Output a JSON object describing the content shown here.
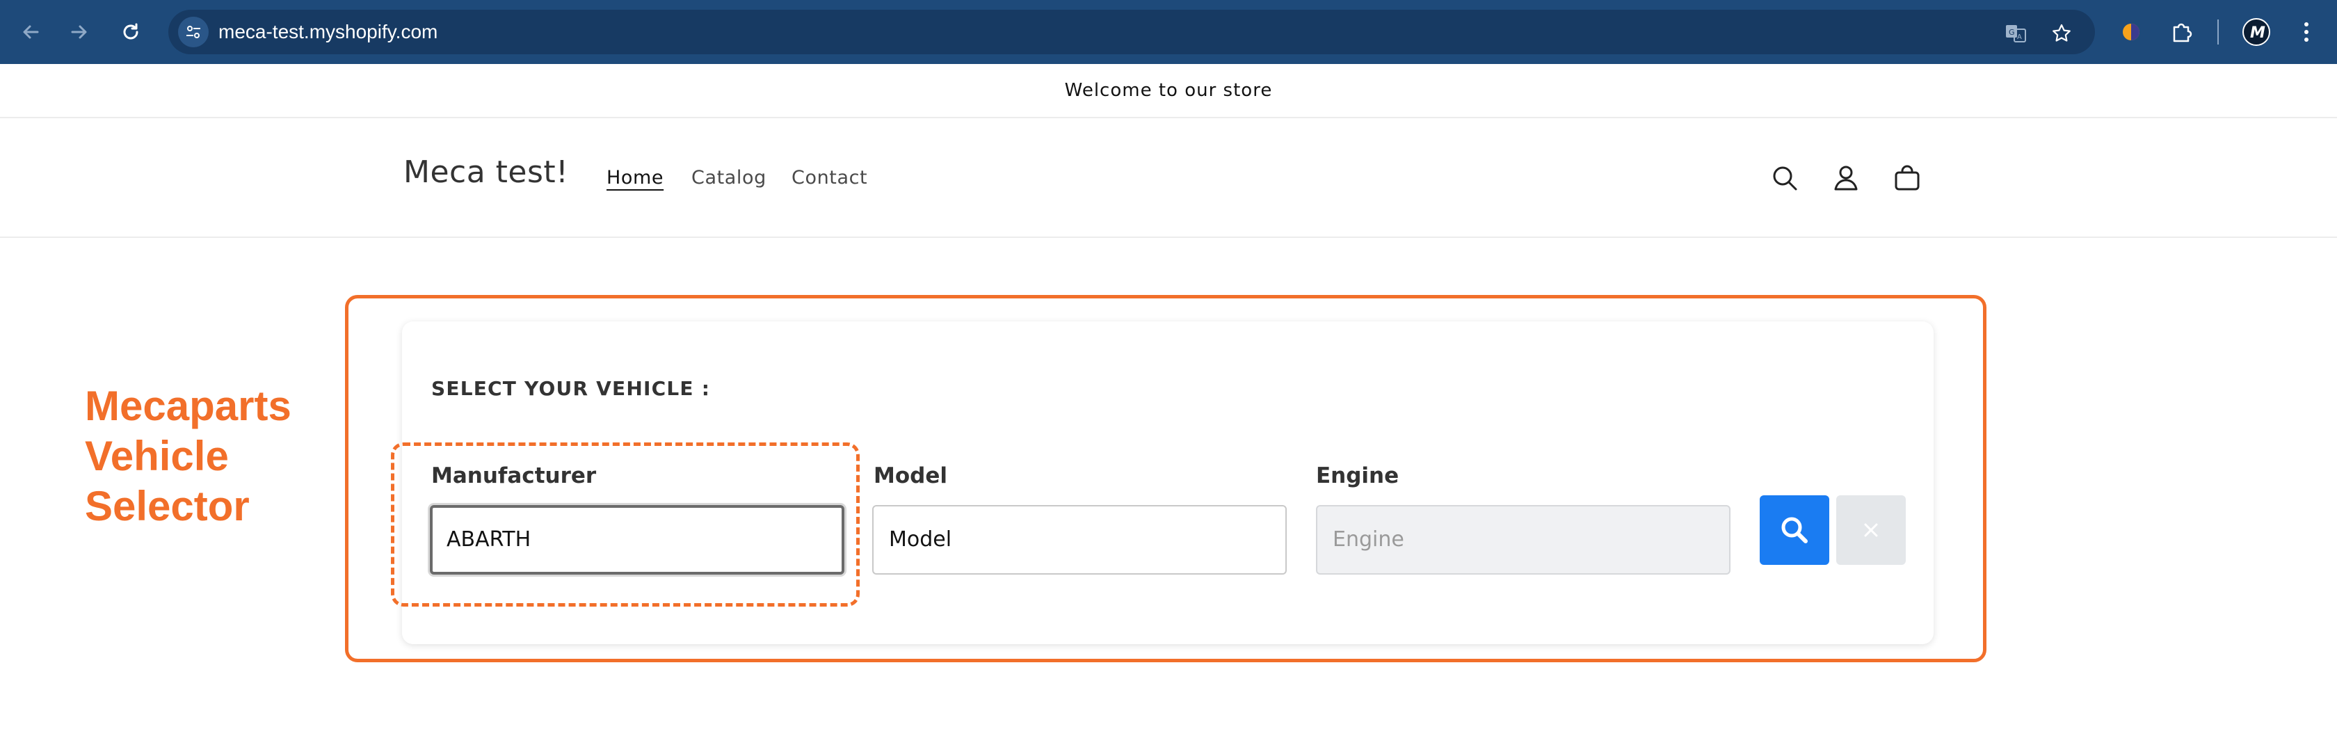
{
  "browser": {
    "url": "meca-test.myshopify.com",
    "icons": [
      "back-arrow-icon",
      "forward-arrow-icon",
      "reload-icon",
      "site-info-icon",
      "translate-icon",
      "bookmark-star-icon",
      "extension-icon",
      "puzzle-icon",
      "profile-icon",
      "more-vert-icon"
    ]
  },
  "announcement": {
    "text": "Welcome to our store"
  },
  "header": {
    "store_name": "Meca test!",
    "nav": [
      {
        "label": "Home",
        "active": true
      },
      {
        "label": "Catalog",
        "active": false
      },
      {
        "label": "Contact",
        "active": false
      }
    ],
    "icons": [
      "search-icon",
      "account-icon",
      "cart-icon"
    ]
  },
  "annotation": {
    "title": "Mecaparts Vehicle Selector",
    "color": "#f26f2a"
  },
  "selector": {
    "title": "SELECT YOUR VEHICLE :",
    "fields": [
      {
        "label": "Manufacturer",
        "value": "ABARTH",
        "placeholder": "",
        "state": "focused"
      },
      {
        "label": "Model",
        "value": "Model",
        "placeholder": "",
        "state": "enabled"
      },
      {
        "label": "Engine",
        "value": "",
        "placeholder": "Engine",
        "state": "disabled"
      }
    ],
    "search_color": "#1a7cf2",
    "clear_color": "#e4e7ea"
  }
}
